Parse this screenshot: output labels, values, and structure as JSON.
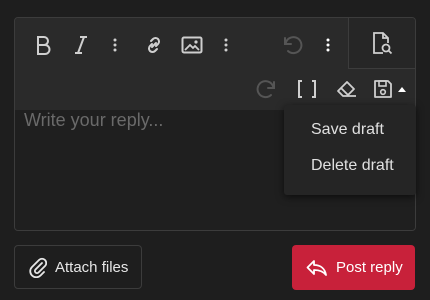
{
  "toolbar": {
    "icons": {
      "bold": "bold-icon",
      "italic": "italic-icon",
      "more1": "more-vertical-icon",
      "link": "link-icon",
      "image": "image-icon",
      "more2": "more-vertical-icon",
      "undo": "undo-icon",
      "more3": "more-vertical-icon",
      "preview": "document-preview-icon",
      "redo": "redo-icon",
      "brackets": "code-brackets-icon",
      "eraser": "eraser-icon",
      "save": "save-draft-icon",
      "caret": "caret-up-icon"
    }
  },
  "editor": {
    "placeholder": "Write your reply..."
  },
  "draft_menu": {
    "items": [
      "Save draft",
      "Delete draft"
    ]
  },
  "actions": {
    "attach_label": "Attach files",
    "post_label": "Post reply"
  },
  "colors": {
    "background": "#1e1e1e",
    "post_button": "#c8213a"
  }
}
